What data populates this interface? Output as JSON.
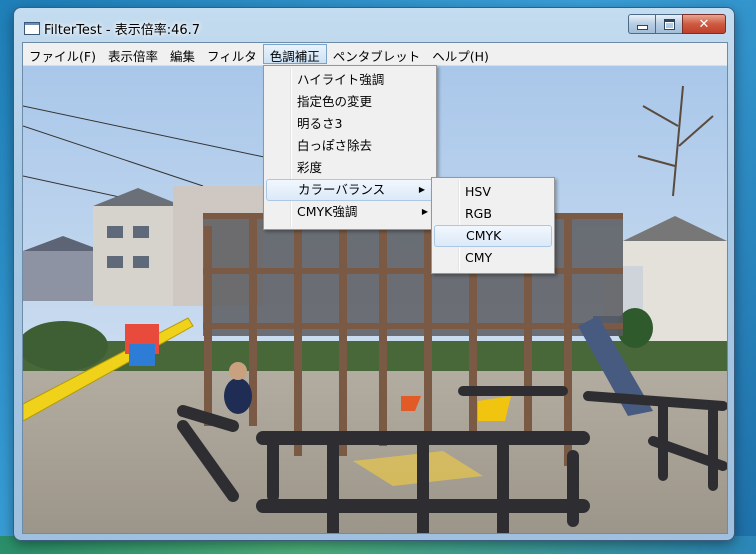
{
  "window": {
    "title": "FilterTest - 表示倍率:46.7"
  },
  "caption": {
    "minimize": "minimize-icon",
    "maximize": "maximize-icon",
    "close": "close-icon"
  },
  "menubar": [
    {
      "label": "ファイル(F)"
    },
    {
      "label": "表示倍率"
    },
    {
      "label": "編集"
    },
    {
      "label": "フィルタ"
    },
    {
      "label": "色調補正",
      "active": true
    },
    {
      "label": "ペンタブレット"
    },
    {
      "label": "ヘルプ(H)"
    }
  ],
  "color_menu": {
    "items": [
      {
        "label": "ハイライト強調"
      },
      {
        "label": "指定色の変更"
      },
      {
        "label": "明るさ3"
      },
      {
        "label": "白っぽさ除去"
      },
      {
        "label": "彩度"
      },
      {
        "label": "カラーバランス",
        "submenu": true,
        "highlighted": true
      },
      {
        "label": "CMYK強調",
        "submenu": true
      }
    ]
  },
  "color_balance_submenu": {
    "items": [
      {
        "label": "HSV"
      },
      {
        "label": "RGB"
      },
      {
        "label": "CMYK",
        "highlighted": true
      },
      {
        "label": "CMY"
      }
    ]
  },
  "photo": {
    "content": "playground-photo"
  }
}
